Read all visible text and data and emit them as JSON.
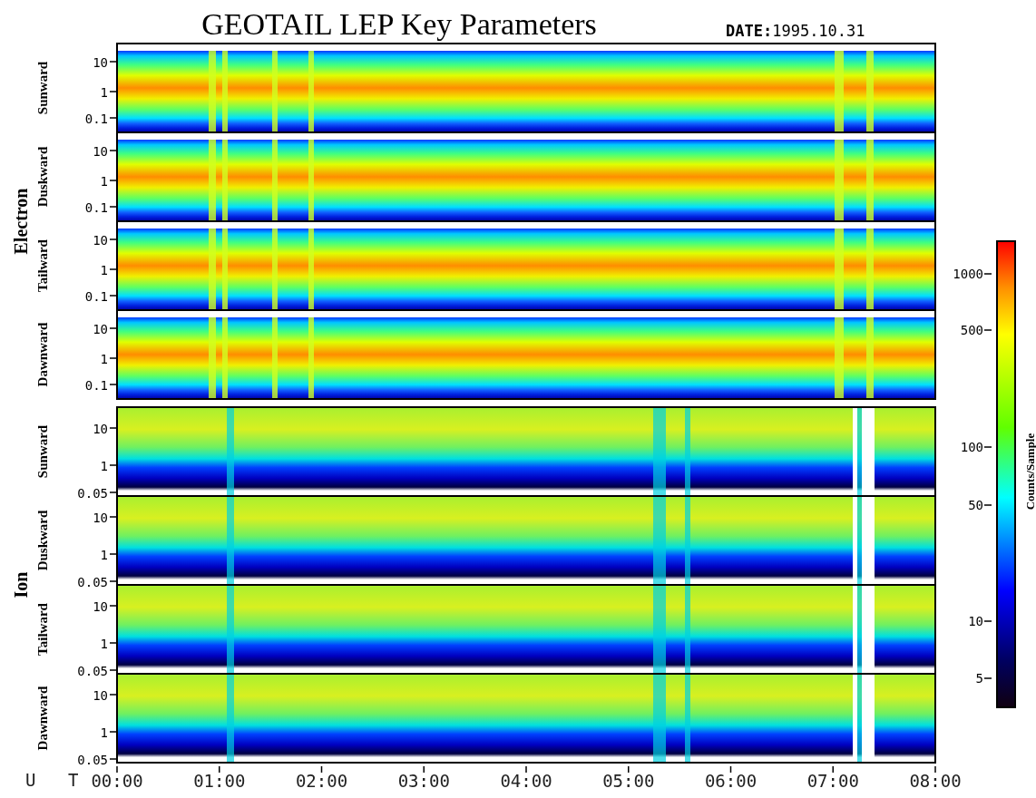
{
  "title": "GEOTAIL LEP Key Parameters",
  "date": "**DATE:**1995.10.31",
  "groups": [
    {
      "label": "Electron",
      "kind": "electron",
      "panels": [
        {
          "label": "Sunward",
          "yticks": [
            "10",
            "1",
            "0.1"
          ]
        },
        {
          "label": "Duskward",
          "yticks": [
            "10",
            "1",
            "0.1"
          ]
        },
        {
          "label": "Tailward",
          "yticks": [
            "10",
            "1",
            "0.1"
          ]
        },
        {
          "label": "Dawnward",
          "yticks": [
            "10",
            "1",
            "0.1"
          ]
        }
      ]
    },
    {
      "label": "Ion",
      "kind": "ion",
      "panels": [
        {
          "label": "Sunward",
          "yticks": [
            "10",
            "1",
            "0.05"
          ]
        },
        {
          "label": "Duskward",
          "yticks": [
            "10",
            "1",
            "0.05"
          ]
        },
        {
          "label": "Tailward",
          "yticks": [
            "10",
            "1",
            "0.05"
          ]
        },
        {
          "label": "Dawnward",
          "yticks": [
            "10",
            "1",
            "0.05"
          ]
        }
      ]
    }
  ],
  "x_axis": {
    "label": "U T",
    "ticks": [
      "00:00",
      "01:00",
      "02:00",
      "03:00",
      "04:00",
      "05:00",
      "06:00",
      "07:00",
      "08:00"
    ]
  },
  "colorbar": {
    "label": "Counts/Sample",
    "ticks": [
      "1000",
      "500",
      "100",
      "50",
      "10",
      "5"
    ]
  }
}
